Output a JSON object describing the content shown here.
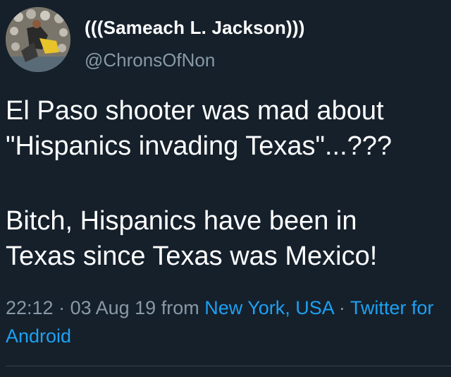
{
  "user": {
    "display_name": "(((Sameach L. Jackson)))",
    "handle": "@ChronsOfNon"
  },
  "tweet": {
    "line1": "El Paso shooter was mad about",
    "line2": "\"Hispanics invading Texas\"...???",
    "line3": "Bitch, Hispanics have been in",
    "line4": "Texas since Texas was Mexico!"
  },
  "meta": {
    "time": "22:12",
    "separator": " · ",
    "date": "03 Aug 19",
    "from_word": " from ",
    "location": "New York, USA",
    "separator2": " · ",
    "source": "Twitter for Android"
  },
  "colors": {
    "background": "#15202b",
    "text": "#ffffff",
    "muted": "#8899a6",
    "link": "#1da1f2"
  }
}
